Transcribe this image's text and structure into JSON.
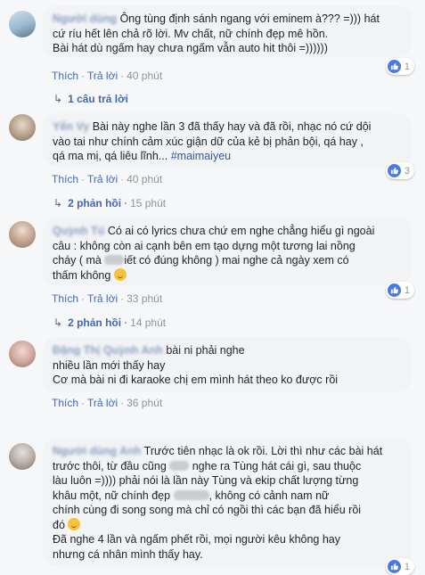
{
  "comments": [
    {
      "author": "Người dùng",
      "text": "Ông tùng định sánh ngang với eminem à??? =))) hát\ncứ ríu hết lên chả rõ lời. Mv chất, nữ chính đẹp mê hồn.\nBài hát dù ngấm hay chưa ngấm vẫn auto hit thôi =))))))",
      "like_label": "Thích",
      "reply_label": "Trả lời",
      "time": "40 phút",
      "like_count": "1",
      "replies": {
        "label": "1 câu trả lời",
        "time": ""
      }
    },
    {
      "author": "Yến Vy",
      "text_before_tag": "Bài này nghe lần 3 đã thấy hay và đã rồi, nhạc nó cứ dội\nvào tai như chính cảm xúc giận dữ của kẻ bị phản bội, qá hay ,\nqá ma mị, qá liêu lĩnh... ",
      "hashtag": "#maimaiyeu",
      "like_label": "Thích",
      "reply_label": "Trả lời",
      "time": "40 phút",
      "like_count": "3",
      "replies": {
        "label": "2 phản hồi",
        "time": "15 phút"
      }
    },
    {
      "author": "Quỳnh Tú",
      "text_a": "Có ai có lyrics chưa chứ em nghe chẳng hiểu gì ngoài\ncâu : không còn ai cạnh bên em tạo dựng một tương lai nồng\ncháy ( mà ",
      "text_b": "iết có đúng không ) mai nghe cả ngày xem có\nthấm không ",
      "like_label": "Thích",
      "reply_label": "Trả lời",
      "time": "33 phút",
      "like_count": "1",
      "replies": {
        "label": "2 phản hồi",
        "time": "14 phút"
      }
    },
    {
      "author": "Đặng Thị Quỳnh Anh",
      "text": "bài ni phải nghe\nnhiều lần mới thấy hay\nCơ mà bài ni đi karaoke chị em mình hát theo ko được rồi",
      "like_label": "Thích",
      "reply_label": "Trả lời",
      "time": "36 phút"
    },
    {
      "author": "Người dùng Anh",
      "text_a": "Trước tiên nhạc là ok rồi. Lời thì như các bài hát\ntrước thôi, từ đầu cũng ",
      "text_b": " nghe ra Tùng hát cái gì, sau thuộc\nlàu luôn =)))) phải nói là lần này Tùng và ekip chất lượng từng\nkhâu một, nữ chính đẹp ",
      "text_c": ", không có cảnh nam nữ\nchính cùng đi song song mà chỉ có ngồi thì các bạn đã hiểu rồi\nđó ",
      "text_d": "\nĐã nghe 4 lần và ngấm phết rồi, mọi người kêu không hay\nnhưng cá nhân mình thấy hay.",
      "like_count": "1"
    }
  ],
  "colors": {
    "link": "#4267b2",
    "author": "#365899",
    "bubble": "#f2f3f5",
    "like_badge": "#4a78e6"
  },
  "icons": {
    "like": "thumbs-up-icon",
    "reply_arrow": "reply-arrow-icon",
    "emoji": "smiley-emoji"
  }
}
